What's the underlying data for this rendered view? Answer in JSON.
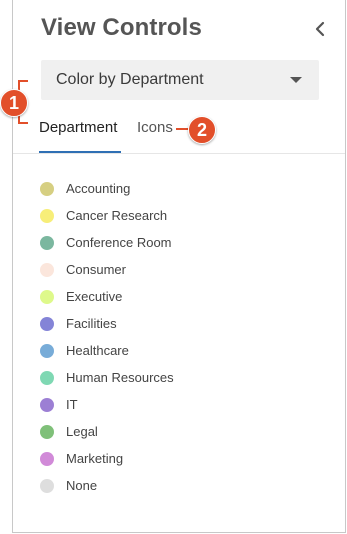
{
  "panel": {
    "title": "View Controls",
    "collapse_icon": "chevron-left-icon"
  },
  "color_by": {
    "selected": "Color by Department",
    "caret_icon": "caret-down-icon"
  },
  "tabs": [
    {
      "label": "Department",
      "active": true
    },
    {
      "label": "Icons",
      "active": false
    }
  ],
  "accent_color": "#2f6fb4",
  "legend": [
    {
      "label": "Accounting",
      "color": "#d6cf82"
    },
    {
      "label": "Cancer Research",
      "color": "#f7ee79"
    },
    {
      "label": "Conference Room",
      "color": "#7bb79f"
    },
    {
      "label": "Consumer",
      "color": "#fbe6dc"
    },
    {
      "label": "Executive",
      "color": "#def98b"
    },
    {
      "label": "Facilities",
      "color": "#8484d7"
    },
    {
      "label": "Healthcare",
      "color": "#78acd8"
    },
    {
      "label": "Human Resources",
      "color": "#7fd8b3"
    },
    {
      "label": "IT",
      "color": "#9c7fd4"
    },
    {
      "label": "Legal",
      "color": "#7fc079"
    },
    {
      "label": "Marketing",
      "color": "#d18ad8"
    },
    {
      "label": "None",
      "color": "#dedede"
    }
  ],
  "callouts": [
    {
      "number": "1",
      "color": "#e24f2a"
    },
    {
      "number": "2",
      "color": "#e24f2a"
    }
  ]
}
